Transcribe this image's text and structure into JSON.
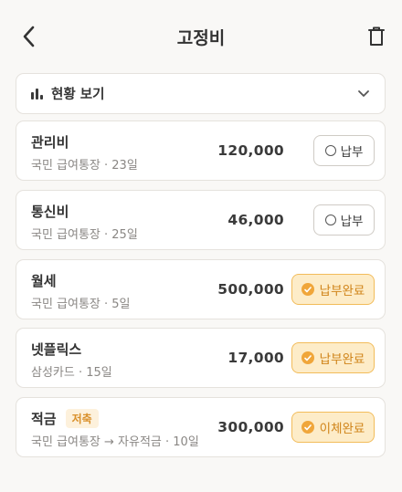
{
  "header": {
    "title": "고정비",
    "back_icon": "chevron-left-icon",
    "delete_icon": "trash-icon"
  },
  "summary": {
    "label": "현황 보기",
    "icon": "bar-chart-icon",
    "toggle_icon": "chevron-down-icon"
  },
  "colors": {
    "accent": "#f0a63a",
    "done_bg": "#fdecc8",
    "done_text": "#d08419",
    "tag_bg": "#fdf1dc"
  },
  "items": [
    {
      "name": "관리비",
      "sub": "국민 급여통장 · 23일",
      "amount": "120,000",
      "status": "납부",
      "done": false
    },
    {
      "name": "통신비",
      "sub": "국민 급여통장 · 25일",
      "amount": "46,000",
      "status": "납부",
      "done": false
    },
    {
      "name": "월세",
      "sub": "국민 급여통장 · 5일",
      "amount": "500,000",
      "status": "납부완료",
      "done": true
    },
    {
      "name": "넷플릭스",
      "sub": "삼성카드 · 15일",
      "amount": "17,000",
      "status": "납부완료",
      "done": true
    },
    {
      "name": "적금",
      "tag": "저축",
      "sub": "국민 급여통장 → 자유적금 · 10일",
      "amount": "300,000",
      "status": "이체완료",
      "done": true
    }
  ]
}
